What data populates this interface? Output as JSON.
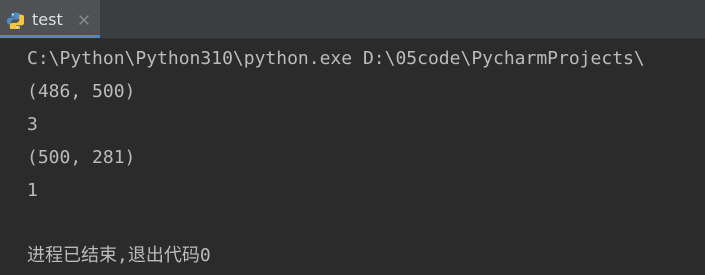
{
  "tab": {
    "label": "test",
    "icon": "python-file-icon",
    "close_icon": "close-icon"
  },
  "console": {
    "lines": [
      "C:\\Python\\Python310\\python.exe D:\\05code\\PycharmProjects\\",
      "(486, 500)",
      "3",
      "(500, 281)",
      "1",
      "进程已结束,退出代码0"
    ]
  },
  "colors": {
    "background": "#2b2b2b",
    "tabbar": "#3c3f41",
    "active_tab": "#4e5254",
    "tab_underline": "#4a88c7",
    "text": "#bbbbbb"
  }
}
